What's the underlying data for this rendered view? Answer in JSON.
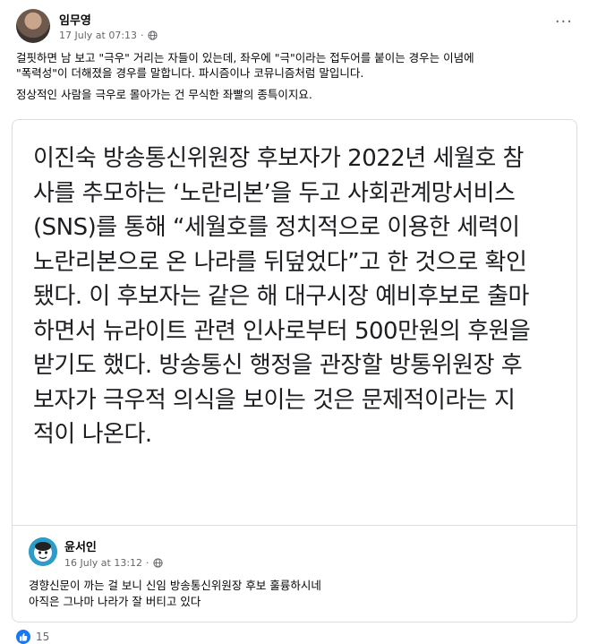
{
  "post": {
    "author": "임무영",
    "timestamp": "17 July at 07:13",
    "privacy_icon": "globe-icon",
    "more_label": "···",
    "text_lines": [
      "걸핏하면 남 보고 \"극우\" 거리는 자들이 있는데, 좌우에 \"극\"이라는 접두어를 붙이는 경우는 이념에",
      "\"폭력성\"이 더해졌을 경우를 말합니다. 파시즘이나 코뮤니즘처럼 말입니다.",
      "정상적인 사람을 극우로 몰아가는 건 무식한 좌빨의 종특이지요."
    ]
  },
  "shared_post": {
    "quote_lines": [
      "이진숙 방송통신위원장 후보자가 2022년 세월호 참",
      "사를 추모하는 ‘노란리본’을 두고 사회관계망서비스",
      "(SNS)를 통해 “세월호를 정치적으로 이용한 세력이",
      "노란리본으로 온 나라를 뒤덮었다”고 한 것으로 확인",
      "됐다. 이 후보자는 같은 해 대구시장 예비후보로 출마",
      "하면서 뉴라이트 관련 인사로부터 500만원의 후원을",
      "받기도 했다. 방송통신 행정을 관장할 방통위원장 후",
      "보자가 극우적 의식을 보이는 것은 문제적이라는 지",
      "적이 나온다."
    ],
    "author": "윤서인",
    "timestamp": "16 July at 13:12",
    "privacy_icon": "globe-icon",
    "text_lines": [
      "경향신문이 까는 걸 보니 신임 방송통신위원장 후보 훌륭하시네",
      "아직은 그나마 나라가 잘 버티고 있다"
    ]
  },
  "reactions": {
    "icon": "like-icon",
    "count": "15",
    "color": "#1877f2"
  }
}
